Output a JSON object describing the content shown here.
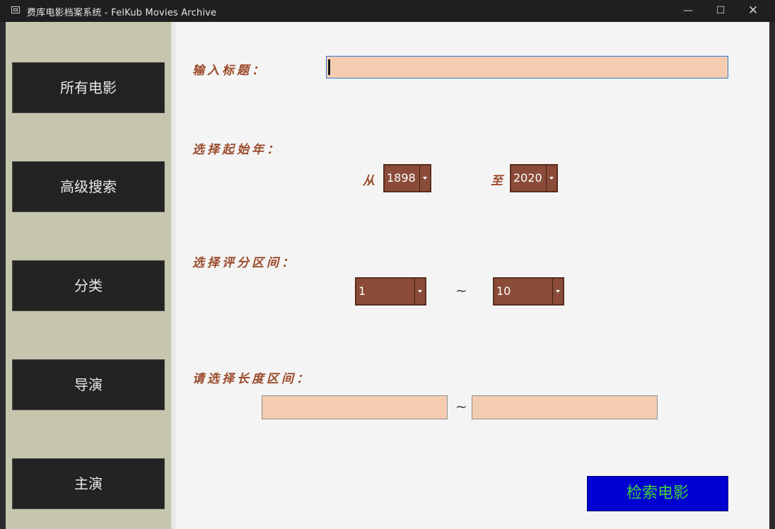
{
  "window": {
    "title": "费库电影档案系统 - FelKub Movies Archive",
    "minimize_glyph": "—",
    "maximize_glyph": "☐",
    "close_glyph": "✕"
  },
  "sidebar": {
    "items": [
      {
        "label": "所有电影"
      },
      {
        "label": "高级搜索"
      },
      {
        "label": "分类"
      },
      {
        "label": "导演"
      },
      {
        "label": "主演"
      }
    ]
  },
  "form": {
    "title_label": "输入标题：",
    "title_value": "",
    "year_label": "选择起始年：",
    "year_from_prefix": "从",
    "year_from": "1898",
    "year_to_prefix": "至",
    "year_to": "2020",
    "rating_label": "选择评分区间：",
    "rating_from": "1",
    "rating_separator": "~",
    "rating_to": "10",
    "length_label": "请选择长度区间：",
    "length_min": "",
    "length_separator": "~",
    "length_max": "",
    "search_button": "检索电影"
  },
  "colors": {
    "sidebar_bg": "#c5c6ad",
    "nav_button_bg": "#232323",
    "combo_bg": "#8a4c38",
    "input_bg": "#f4ccb0",
    "label_color": "#9a4a2a",
    "search_button_bg": "#0000d0",
    "search_button_text": "#3fd13f"
  },
  "icons": {
    "app": "window-icon",
    "dropdown": "chevron-down-icon"
  }
}
